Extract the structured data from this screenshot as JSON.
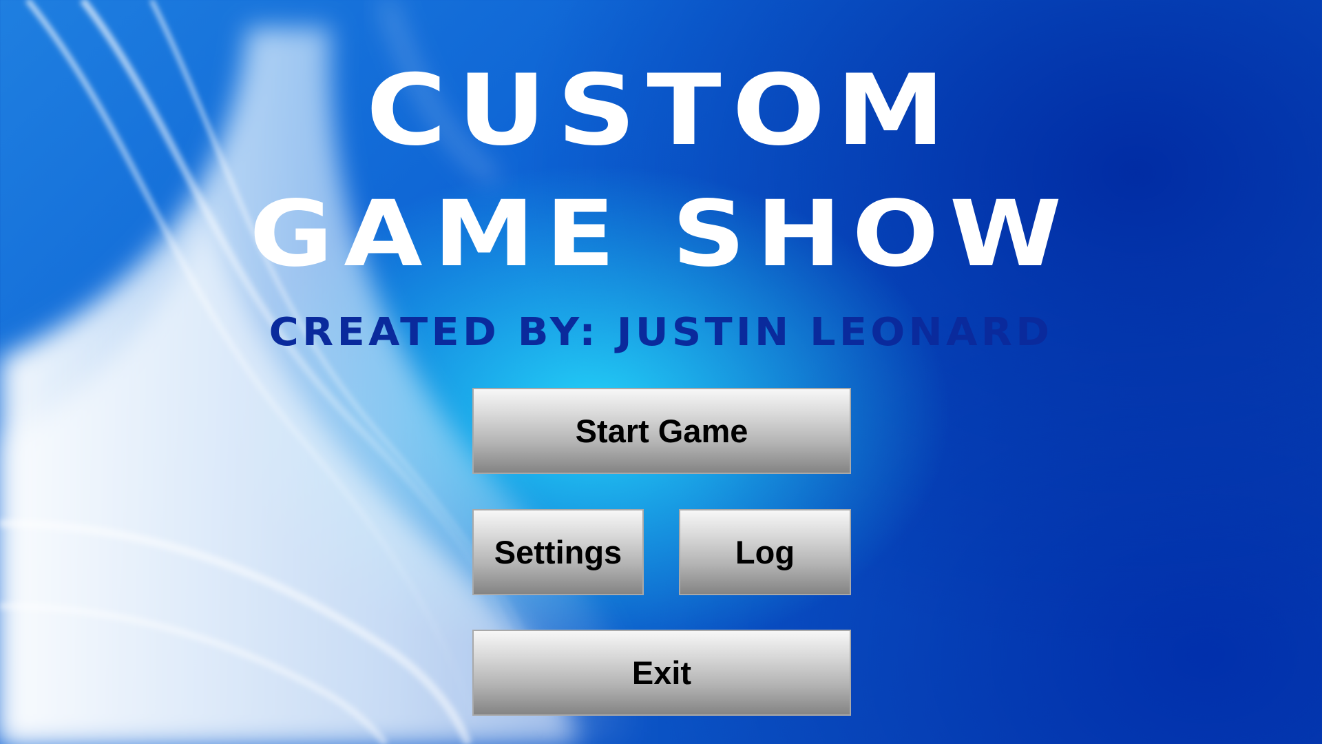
{
  "title": {
    "line1": "CUSTOM",
    "line2": "GAME SHOW",
    "subtitle": "CREATED BY: JUSTIN LEONARD"
  },
  "menu": {
    "start_label": "Start Game",
    "settings_label": "Settings",
    "log_label": "Log",
    "exit_label": "Exit"
  },
  "colors": {
    "background": "#0d63d4",
    "title": "#ffffff",
    "subtitle": "#0a2a9c",
    "button_top": "#f7f7f7",
    "button_bottom": "#848484"
  }
}
